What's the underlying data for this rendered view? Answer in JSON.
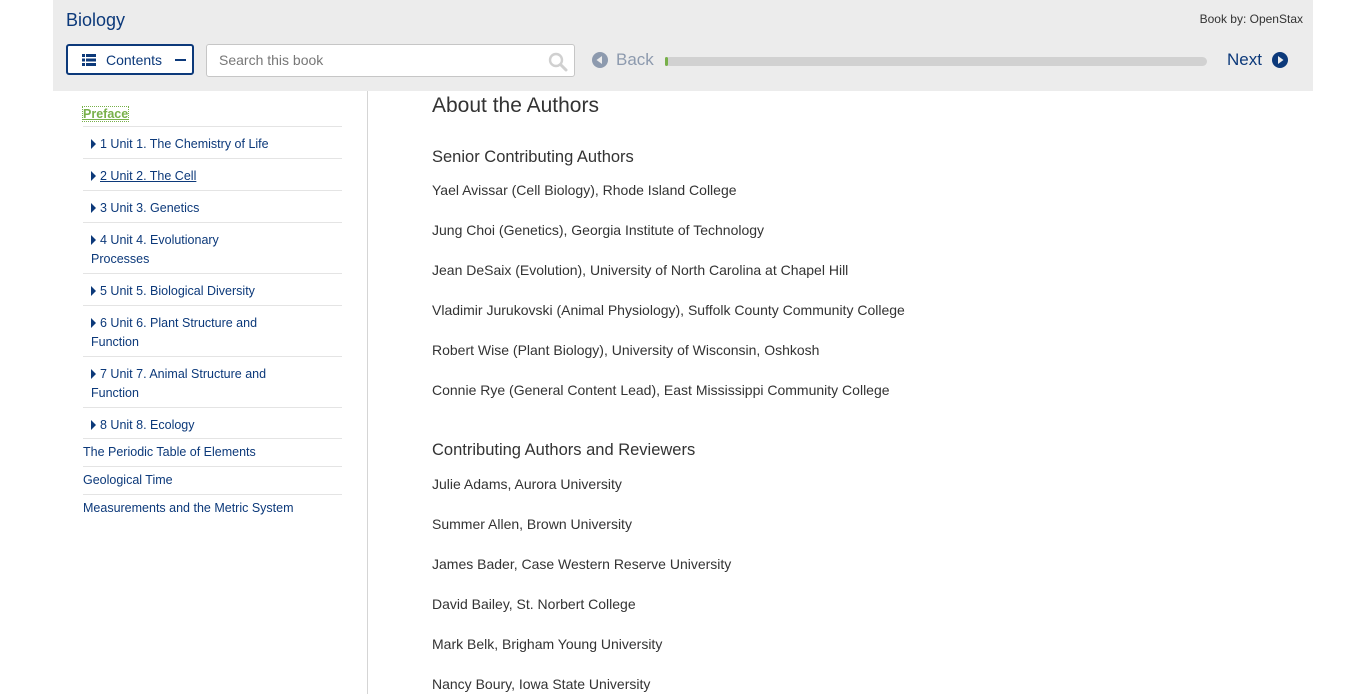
{
  "header": {
    "book_title": "Biology",
    "book_by": "Book by: OpenStax",
    "contents_label": "Contents",
    "search_placeholder": "Search this book",
    "back_label": "Back",
    "next_label": "Next",
    "progress_fraction": 0.0
  },
  "sidebar": {
    "preface": "Preface",
    "units": [
      "1 Unit 1. The Chemistry of Life",
      "2 Unit 2. The Cell",
      "3 Unit 3. Genetics",
      "4 Unit 4. Evolutionary Processes",
      "5 Unit 5. Biological Diversity",
      "6 Unit 6. Plant Structure and Function",
      "7 Unit 7. Animal Structure and Function",
      "8 Unit 8. Ecology"
    ],
    "appendices": [
      "The Periodic Table of Elements",
      "Geological Time",
      "Measurements and the Metric System"
    ]
  },
  "main": {
    "title": "About the Authors",
    "senior_heading": "Senior Contributing Authors",
    "senior_authors": [
      "Yael Avissar (Cell Biology), Rhode Island College",
      "Jung Choi (Genetics), Georgia Institute of Technology",
      "Jean DeSaix (Evolution), University of North Carolina at Chapel Hill",
      "Vladimir Jurukovski (Animal Physiology), Suffolk County Community College",
      "Robert Wise (Plant Biology), University of Wisconsin, Oshkosh",
      "Connie Rye (General Content Lead), East Mississippi Community College"
    ],
    "contrib_heading": "Contributing Authors and Reviewers",
    "contrib_authors": [
      "Julie Adams, Aurora University",
      "Summer Allen, Brown University",
      "James Bader, Case Western Reserve University",
      "David Bailey, St. Norbert College",
      "Mark Belk, Brigham Young University",
      "Nancy Boury, Iowa State University"
    ]
  },
  "colors": {
    "accent_navy": "#0c397a",
    "preface_green": "#78b04a",
    "header_bg": "#ececec"
  }
}
